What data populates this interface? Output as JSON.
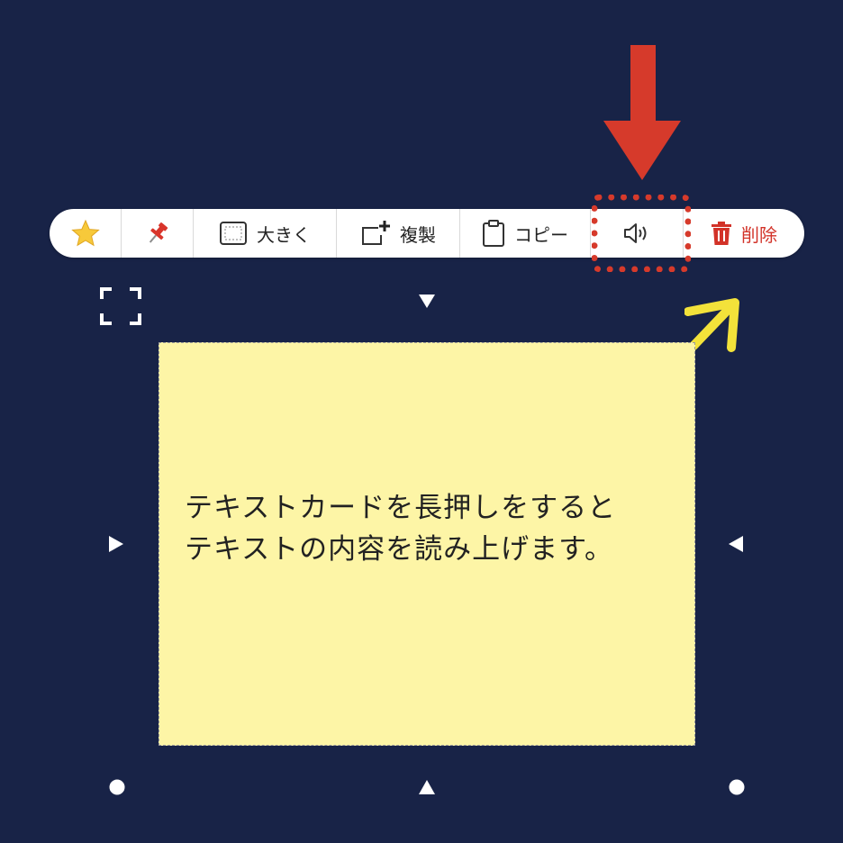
{
  "toolbar": {
    "items": [
      {
        "icon": "star-icon",
        "label": ""
      },
      {
        "icon": "pin-icon",
        "label": ""
      },
      {
        "icon": "enlarge-icon",
        "label": "大きく"
      },
      {
        "icon": "duplicate-icon",
        "label": "複製"
      },
      {
        "icon": "clipboard-icon",
        "label": "コピー"
      },
      {
        "icon": "speaker-icon",
        "label": ""
      },
      {
        "icon": "trash-icon",
        "label": "削除"
      }
    ]
  },
  "card": {
    "text": "テキストカードを長押しをすると\nテキストの内容を読み上げます。"
  },
  "colors": {
    "background": "#182347",
    "card": "#fdf5a6",
    "highlight": "#d63a2b",
    "arrow_red": "#d63a2b",
    "arrow_yellow": "#f3e23a",
    "delete": "#d23228"
  }
}
